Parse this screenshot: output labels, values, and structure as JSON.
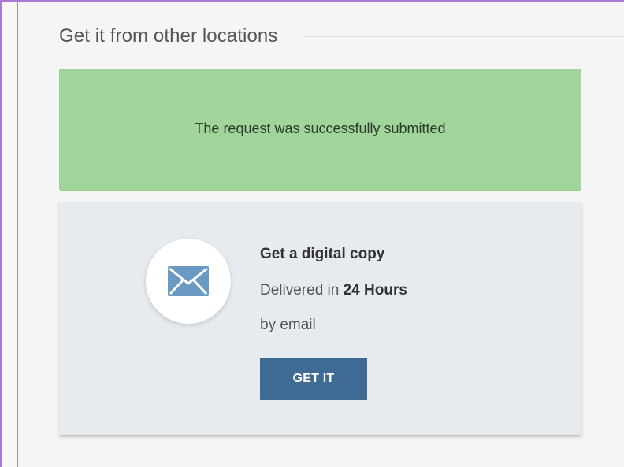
{
  "section": {
    "title": "Get it from other locations"
  },
  "alert": {
    "message": "The request was successfully submitted",
    "color": "#a1d59c"
  },
  "digital_copy": {
    "icon": "envelope-icon",
    "title": "Get a digital copy",
    "delivery_prefix": "Delivered in",
    "delivery_time": "24 Hours",
    "method": "by email",
    "button_label": "GET IT",
    "button_color": "#3e6a93"
  }
}
